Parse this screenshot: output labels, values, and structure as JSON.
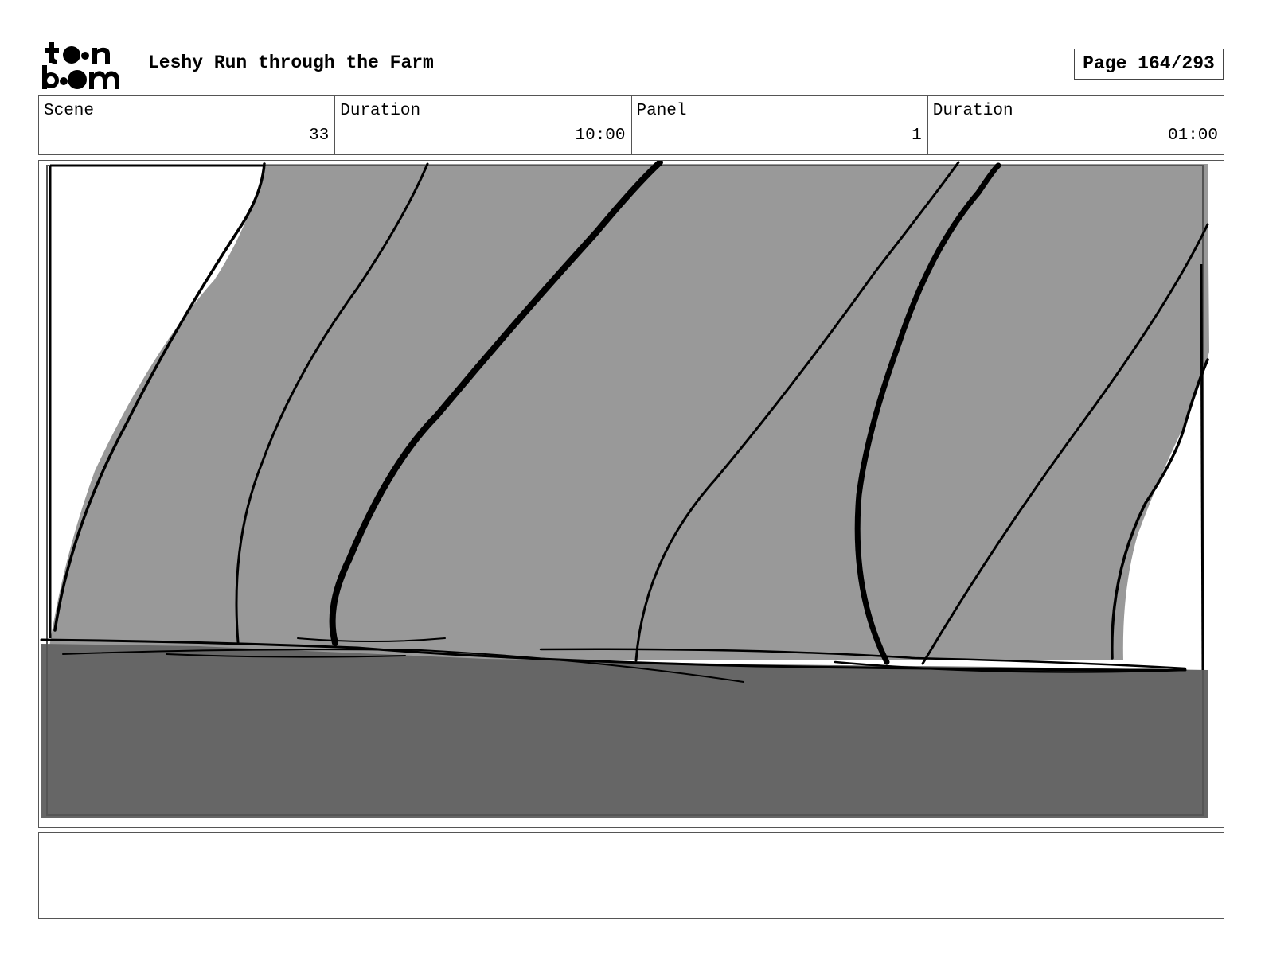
{
  "header": {
    "logo_text": "toon boom",
    "project_title": "Leshy Run through the Farm",
    "page_label": "Page 164/293"
  },
  "info": {
    "scene_label": "Scene",
    "scene_value": "33",
    "scene_duration_label": "Duration",
    "scene_duration_value": "10:00",
    "panel_label": "Panel",
    "panel_value": "1",
    "panel_duration_label": "Duration",
    "panel_duration_value": "01:00"
  },
  "drawing": {
    "description_icon": "storyboard-sketch",
    "colors": {
      "light_gray": "#999999",
      "dark_gray": "#666666",
      "ink": "#000000"
    }
  },
  "notes": {
    "text": ""
  }
}
